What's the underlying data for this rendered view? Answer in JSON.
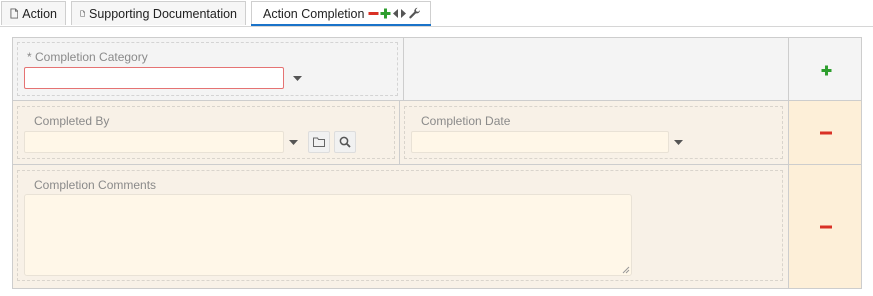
{
  "tabs": [
    {
      "label": "Action"
    },
    {
      "label": "Supporting Documentation"
    },
    {
      "label": "Action Completion",
      "active": true
    }
  ],
  "tab_tools": [
    "minus-icon",
    "plus-icon",
    "prev-arrow-icon",
    "next-arrow-icon",
    "wrench-icon"
  ],
  "form": {
    "completion_category": {
      "label": "* Completion Category",
      "value": "",
      "required": true
    },
    "completed_by": {
      "label": "Completed By",
      "value": ""
    },
    "completion_date": {
      "label": "Completion Date",
      "value": ""
    },
    "completion_comments": {
      "label": "Completion Comments",
      "value": ""
    }
  },
  "colors": {
    "accent": "#1a73c9",
    "add_green": "#2e9e2e",
    "remove_red": "#d93025",
    "required_border": "#e57373",
    "row_warm": "#f8f1e7",
    "side_warm": "#fdefd8"
  }
}
